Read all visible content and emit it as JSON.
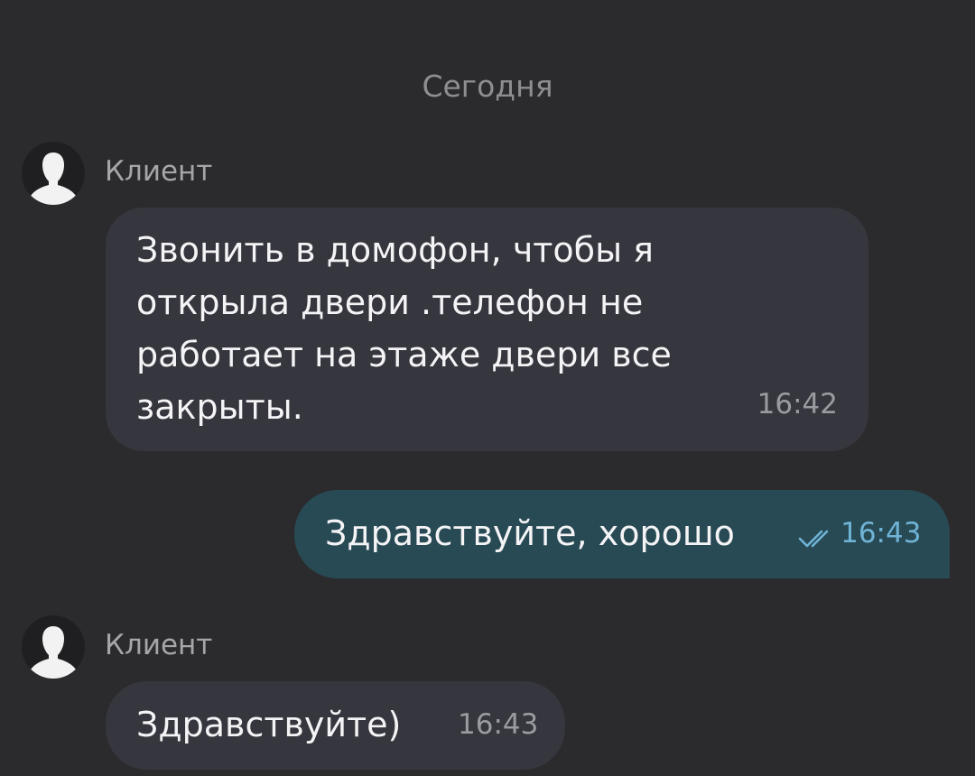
{
  "date_divider": "Сегодня",
  "colors": {
    "background": "#2b2b2d",
    "incoming_bubble": "#36363e",
    "outgoing_bubble": "#284a54",
    "read_check": "#6fb3d6"
  },
  "messages": [
    {
      "sender": "Клиент",
      "avatar_icon": "user-silhouette-icon",
      "text": "Звонить в домофон, чтобы я открыла двери .телефон не работает на этаже двери все закрыты.",
      "time": "16:42",
      "direction": "incoming"
    },
    {
      "text": "Здравствуйте, хорошо",
      "time": "16:43",
      "direction": "outgoing",
      "status_icon": "double-check-icon"
    },
    {
      "sender": "Клиент",
      "avatar_icon": "user-silhouette-icon",
      "text": "Здравствуйте)",
      "time": "16:43",
      "direction": "incoming"
    }
  ]
}
